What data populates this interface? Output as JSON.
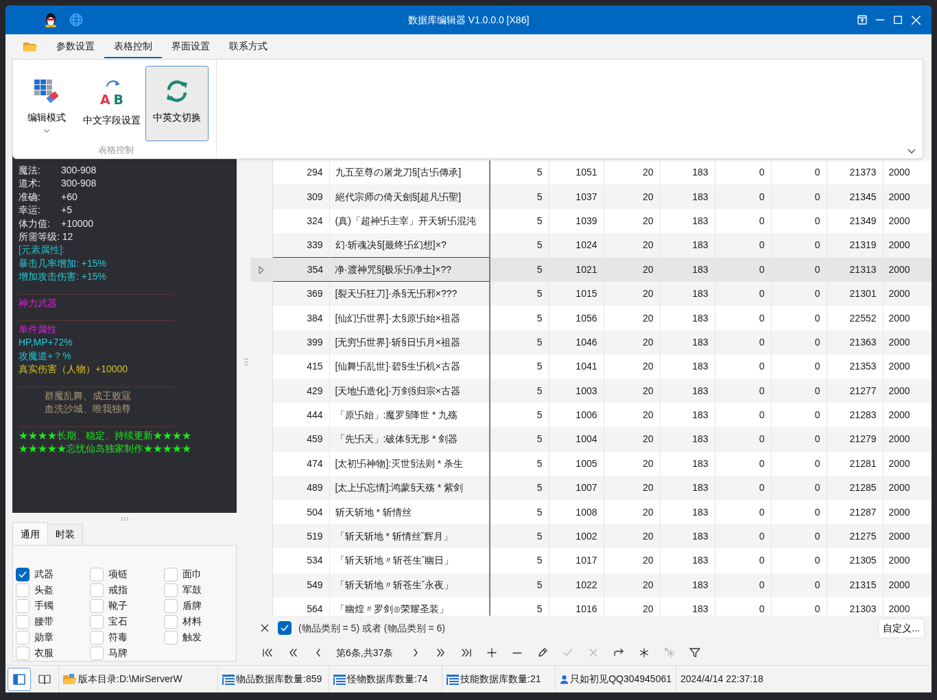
{
  "window": {
    "title": "数据库编辑器 V1.0.0.0 [X86]"
  },
  "menu_tabs": [
    {
      "label": "参数设置",
      "selected": false
    },
    {
      "label": "表格控制",
      "selected": true
    },
    {
      "label": "界面设置",
      "selected": false
    },
    {
      "label": "联系方式",
      "selected": false
    }
  ],
  "ribbon": {
    "group_label": "表格控制",
    "buttons": [
      {
        "kind": "editmode",
        "label": "编辑模式",
        "dropdown": true,
        "selected": false
      },
      {
        "kind": "letters",
        "label": "中文字段设置",
        "icon_letters": [
          "A",
          "B"
        ],
        "dropdown": false,
        "selected": false
      },
      {
        "kind": "sync",
        "label": "中英文切换",
        "dropdown": false,
        "selected": true
      }
    ]
  },
  "tooltip": {
    "lines": [
      {
        "kind": "stat",
        "label": "魔法:",
        "value": "300-908"
      },
      {
        "kind": "stat",
        "label": "道术:",
        "value": "300-908"
      },
      {
        "kind": "stat",
        "label": "准确:",
        "value": "+60"
      },
      {
        "kind": "stat",
        "label": "幸运:",
        "value": "+5"
      },
      {
        "kind": "stat",
        "label": "体力值:",
        "value": "+10000"
      },
      {
        "kind": "text",
        "text": "所需等级: 12",
        "color": "#e6e6e6"
      },
      {
        "kind": "text",
        "text": "[元素属性]:",
        "color": "#22b8cc"
      },
      {
        "kind": "text",
        "text": "暴击几率增加: +15%",
        "color": "#22c8d8"
      },
      {
        "kind": "text",
        "text": "增加攻击伤害: +15%",
        "color": "#22c8d8"
      },
      {
        "kind": "divider"
      },
      {
        "kind": "text",
        "text": "神力武器",
        "color": "#e21ce2"
      },
      {
        "kind": "divider"
      },
      {
        "kind": "text",
        "text": "单件属性",
        "color": "#e21ce2"
      },
      {
        "kind": "text",
        "text": "HP,MP+72%",
        "color": "#22c8d8"
      },
      {
        "kind": "text",
        "text": "攻魔道+？%",
        "color": "#22c8d8"
      },
      {
        "kind": "text",
        "text": "真实伤害（人物）+10000",
        "color": "#d4c21e"
      },
      {
        "kind": "divider"
      },
      {
        "kind": "poem",
        "text": "群魔乱舞、成王败寇",
        "color": "#a89878"
      },
      {
        "kind": "poem",
        "text": "血洗沙城、唯我独尊",
        "color": "#a89878"
      },
      {
        "kind": "divider"
      },
      {
        "kind": "text",
        "text": "★★★★长期、稳定、持续更新★★★★",
        "color": "#1ee61e"
      },
      {
        "kind": "text",
        "text": "★★★★★忘忧仙岛独家制作★★★★★",
        "color": "#1ee61e"
      }
    ]
  },
  "category_tabs": [
    {
      "label": "通用",
      "selected": true
    },
    {
      "label": "时装",
      "selected": false
    }
  ],
  "categories": [
    {
      "label": "武器",
      "checked": true
    },
    {
      "label": "项链",
      "checked": false
    },
    {
      "label": "面巾",
      "checked": false
    },
    {
      "label": "头盔",
      "checked": false
    },
    {
      "label": "戒指",
      "checked": false
    },
    {
      "label": "军鼓",
      "checked": false
    },
    {
      "label": "手镯",
      "checked": false
    },
    {
      "label": "靴子",
      "checked": false
    },
    {
      "label": "盾牌",
      "checked": false
    },
    {
      "label": "腰带",
      "checked": false
    },
    {
      "label": "宝石",
      "checked": false
    },
    {
      "label": "材料",
      "checked": false
    },
    {
      "label": "勋章",
      "checked": false
    },
    {
      "label": "符毒",
      "checked": false
    },
    {
      "label": "触发",
      "checked": false
    },
    {
      "label": "衣服",
      "checked": false
    },
    {
      "label": "马牌",
      "checked": false
    }
  ],
  "table": {
    "rows": [
      {
        "id": "294",
        "name": "九五至尊の屠龙刀§[古卐傳承]",
        "cells": [
          "5",
          "1051",
          "20",
          "183",
          "0",
          "0",
          "21373",
          "2000"
        ],
        "selected": false
      },
      {
        "id": "309",
        "name": "絕代宗师の倚天劍§[超凡卐聖]",
        "cells": [
          "5",
          "1037",
          "20",
          "183",
          "0",
          "0",
          "21345",
          "2000"
        ],
        "selected": false
      },
      {
        "id": "324",
        "name": "(真)「超神卐主宰」开天斩卐混沌",
        "cells": [
          "5",
          "1039",
          "20",
          "183",
          "0",
          "0",
          "21349",
          "2000"
        ],
        "selected": false
      },
      {
        "id": "339",
        "name": "幻·斩魂决§[最终卐幻想]×?",
        "cells": [
          "5",
          "1024",
          "20",
          "183",
          "0",
          "0",
          "21319",
          "2000"
        ],
        "selected": false
      },
      {
        "id": "354",
        "name": "净·渡神咒§[极乐卐净土]×??",
        "cells": [
          "5",
          "1021",
          "20",
          "183",
          "0",
          "0",
          "21313",
          "2000"
        ],
        "selected": true
      },
      {
        "id": "369",
        "name": "[裂天卐狂刀]·杀§无卐邪×???",
        "cells": [
          "5",
          "1015",
          "20",
          "183",
          "0",
          "0",
          "21301",
          "2000"
        ],
        "selected": false
      },
      {
        "id": "384",
        "name": "[仙幻卐世界]·太§原卐始×祖器",
        "cells": [
          "5",
          "1056",
          "20",
          "183",
          "0",
          "0",
          "22552",
          "2000"
        ],
        "selected": false
      },
      {
        "id": "399",
        "name": "[无穷卐世界]·斩§日卐月×祖器",
        "cells": [
          "5",
          "1046",
          "20",
          "183",
          "0",
          "0",
          "21363",
          "2000"
        ],
        "selected": false
      },
      {
        "id": "415",
        "name": "[仙舞卐乱世]·碧§生卐机×古器",
        "cells": [
          "5",
          "1041",
          "20",
          "183",
          "0",
          "0",
          "21353",
          "2000"
        ],
        "selected": false
      },
      {
        "id": "429",
        "name": "[天地卐造化]·万剑§归宗×古器",
        "cells": [
          "5",
          "1003",
          "20",
          "183",
          "0",
          "0",
          "21277",
          "2000"
        ],
        "selected": false
      },
      {
        "id": "444",
        "name": "「原卐始」:魔罗§降世 * 九殇",
        "cells": [
          "5",
          "1006",
          "20",
          "183",
          "0",
          "0",
          "21283",
          "2000"
        ],
        "selected": false
      },
      {
        "id": "459",
        "name": "「先卐天」:破体§无形 * 剑器",
        "cells": [
          "5",
          "1004",
          "20",
          "183",
          "0",
          "0",
          "21279",
          "2000"
        ],
        "selected": false
      },
      {
        "id": "474",
        "name": "[太初卐神物]:灭世§法则 * 杀生",
        "cells": [
          "5",
          "1005",
          "20",
          "183",
          "0",
          "0",
          "21281",
          "2000"
        ],
        "selected": false
      },
      {
        "id": "489",
        "name": "[太上卐忘情]:鸿蒙§天殇 * 紫剑",
        "cells": [
          "5",
          "1007",
          "20",
          "183",
          "0",
          "0",
          "21285",
          "2000"
        ],
        "selected": false
      },
      {
        "id": "504",
        "name": "斩天斩地 * 斩情丝",
        "cells": [
          "5",
          "1008",
          "20",
          "183",
          "0",
          "0",
          "21287",
          "2000"
        ],
        "selected": false
      },
      {
        "id": "519",
        "name": "「斩天斩地 * 斩情丝ˇ辉月」",
        "cells": [
          "5",
          "1002",
          "20",
          "183",
          "0",
          "0",
          "21275",
          "2000"
        ],
        "selected": false
      },
      {
        "id": "534",
        "name": "「斩天斩地〃斩苍生ˇ幽日」",
        "cells": [
          "5",
          "1017",
          "20",
          "183",
          "0",
          "0",
          "21305",
          "2000"
        ],
        "selected": false
      },
      {
        "id": "549",
        "name": "「斩天斩地〃斩苍生ˇ永夜」",
        "cells": [
          "5",
          "1022",
          "20",
          "183",
          "0",
          "0",
          "21315",
          "2000"
        ],
        "selected": false
      },
      {
        "id": "564",
        "name": "「幽煌〃罗剑⊙荣耀圣装」",
        "cells": [
          "5",
          "1016",
          "20",
          "183",
          "0",
          "0",
          "21303",
          "2000"
        ],
        "selected": false
      }
    ]
  },
  "filter": {
    "checked": true,
    "text": "(物品类别 = 5) 或者 (物品类别 = 6)",
    "button": "自定义..."
  },
  "navigator": {
    "record_text": "第6条,共37条",
    "buttons": [
      {
        "kind": "first",
        "disabled": false
      },
      {
        "kind": "prevpage",
        "disabled": false
      },
      {
        "kind": "prev",
        "disabled": false
      },
      {
        "kind": "record"
      },
      {
        "kind": "next",
        "disabled": false
      },
      {
        "kind": "nextpage",
        "disabled": false
      },
      {
        "kind": "last",
        "disabled": false
      },
      {
        "kind": "append",
        "disabled": false
      },
      {
        "kind": "delete",
        "disabled": false
      },
      {
        "kind": "edit",
        "disabled": false
      },
      {
        "kind": "post",
        "disabled": true
      },
      {
        "kind": "cancel",
        "disabled": true
      },
      {
        "kind": "refresh",
        "disabled": false
      },
      {
        "kind": "bookmark",
        "disabled": false
      },
      {
        "kind": "gotobookmark",
        "disabled": true
      },
      {
        "kind": "filter",
        "disabled": false
      }
    ]
  },
  "status_bar": {
    "sidebar_toggle_selected": true,
    "items": [
      {
        "kind": "folder",
        "text": "版本目录:D:\\MirServerW"
      },
      {
        "kind": "database",
        "text": "物品数据库数量:859"
      },
      {
        "kind": "database",
        "text": "怪物数据库数量:74"
      },
      {
        "kind": "database",
        "text": "技能数据库数量:21"
      },
      {
        "kind": "user",
        "text": "只如初见QQ304945061"
      },
      {
        "kind": "plain",
        "text": "2024/4/14 22:37:18"
      }
    ]
  }
}
